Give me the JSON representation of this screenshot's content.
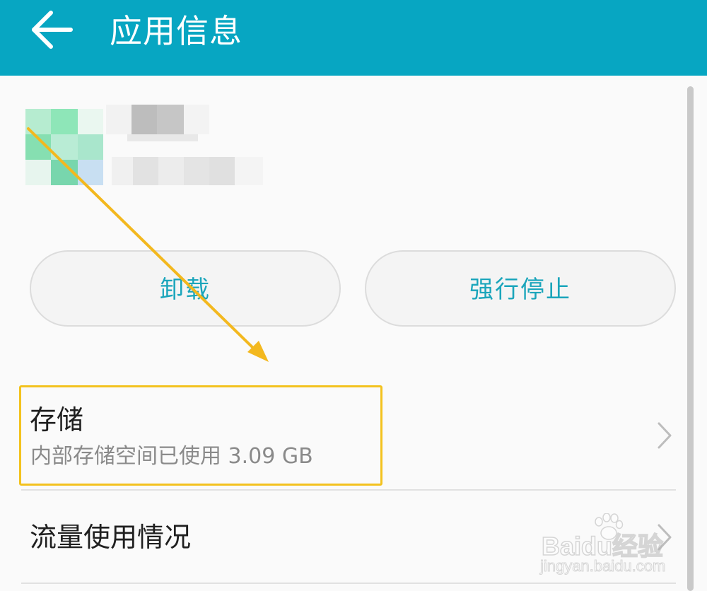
{
  "header": {
    "back_icon": "arrow-left-icon",
    "title": "应用信息",
    "background_color": "#07a6c2"
  },
  "app": {
    "icon": "pixelated-app-icon",
    "name_obscured": true,
    "version_obscured": true
  },
  "actions": {
    "uninstall_label": "卸载",
    "force_stop_label": "强行停止",
    "accent_color": "#1aa5bb"
  },
  "rows": [
    {
      "title": "存储",
      "subtitle": "内部存储空间已使用 3.09 GB",
      "icon": "chevron-right-icon"
    },
    {
      "title": "流量使用情况",
      "icon": "chevron-right-icon"
    }
  ],
  "annotation": {
    "highlight_color": "#f3c21e",
    "arrow_color": "#f3b81e"
  },
  "watermark": {
    "brand": "Baidu经验",
    "url": "jingyan.baidu.com"
  }
}
